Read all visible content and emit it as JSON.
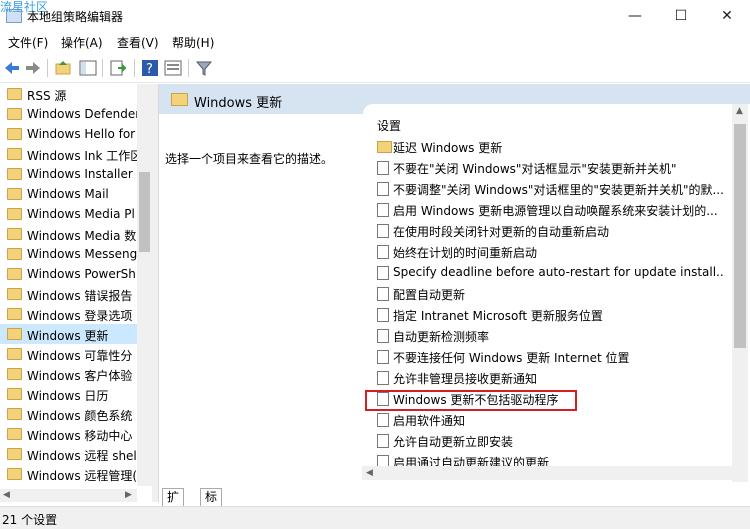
{
  "window": {
    "watermark": "流星社区",
    "title": "本地组策略编辑器",
    "minimize": "—",
    "maximize": "☐",
    "close": "✕"
  },
  "menu": [
    "文件(F)",
    "操作(A)",
    "查看(V)",
    "帮助(H)"
  ],
  "toolbar": {
    "icons": [
      "back-arrow-icon",
      "forward-arrow-icon",
      "up-folder-icon",
      "show-hide-tree-icon",
      "export-list-icon",
      "help-icon",
      "properties-icon",
      "filter-icon"
    ]
  },
  "tree": {
    "items": [
      {
        "label": "RSS 源"
      },
      {
        "label": "Windows Defender"
      },
      {
        "label": "Windows Hello for"
      },
      {
        "label": "Windows Ink 工作区"
      },
      {
        "label": "Windows Installer"
      },
      {
        "label": "Windows Mail"
      },
      {
        "label": "Windows Media Pl"
      },
      {
        "label": "Windows Media 数"
      },
      {
        "label": "Windows Messeng"
      },
      {
        "label": "Windows PowerSh"
      },
      {
        "label": "Windows 错误报告"
      },
      {
        "label": "Windows 登录选项"
      },
      {
        "label": "Windows 更新",
        "selected": true
      },
      {
        "label": "Windows 可靠性分"
      },
      {
        "label": "Windows 客户体验"
      },
      {
        "label": "Windows 日历"
      },
      {
        "label": "Windows 颜色系统"
      },
      {
        "label": "Windows 移动中心"
      },
      {
        "label": "Windows 远程 shel"
      },
      {
        "label": "Windows 远程管理("
      }
    ]
  },
  "right": {
    "header": "Windows 更新",
    "description": "选择一个项目来查看它的描述。",
    "column_header": "设置",
    "rows": [
      {
        "label": "延迟 Windows 更新",
        "type": "folder"
      },
      {
        "label": "不要在\"关闭 Windows\"对话框显示\"安装更新并关机\"",
        "type": "setting"
      },
      {
        "label": "不要调整\"关闭 Windows\"对话框里的\"安装更新并关机\"的默...",
        "type": "setting"
      },
      {
        "label": "启用 Windows 更新电源管理以自动唤醒系统来安装计划的...",
        "type": "setting"
      },
      {
        "label": "在使用时段关闭针对更新的自动重新启动",
        "type": "setting"
      },
      {
        "label": "始终在计划的时间重新启动",
        "type": "setting"
      },
      {
        "label": "Specify deadline before auto-restart for update install...",
        "type": "setting"
      },
      {
        "label": "配置自动更新",
        "type": "setting"
      },
      {
        "label": "指定 Intranet Microsoft 更新服务位置",
        "type": "setting"
      },
      {
        "label": "自动更新检测频率",
        "type": "setting"
      },
      {
        "label": "不要连接任何 Windows 更新 Internet 位置",
        "type": "setting"
      },
      {
        "label": "允许非管理员接收更新通知",
        "type": "setting"
      },
      {
        "label": "Windows 更新不包括驱动程序",
        "type": "setting"
      },
      {
        "label": "启用软件通知",
        "type": "setting"
      },
      {
        "label": "允许自动更新立即安装",
        "type": "setting"
      },
      {
        "label": "启用通过自动更新建议的更新",
        "type": "setting"
      }
    ]
  },
  "tabs": [
    "扩展",
    "标准"
  ],
  "status": "21 个设置"
}
